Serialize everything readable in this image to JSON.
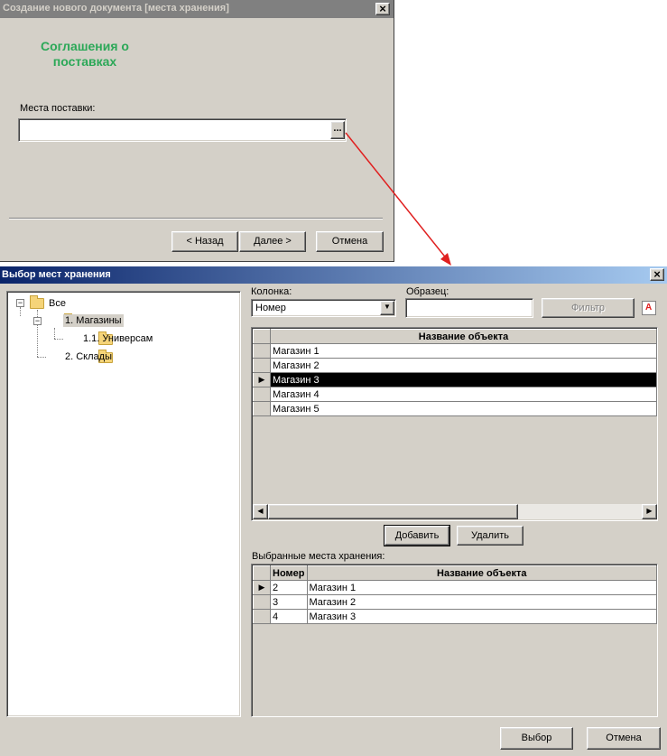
{
  "dialog1": {
    "title": "Создание нового документа [места хранения]",
    "heading_line1": "Соглашения о",
    "heading_line2": "поставках",
    "field_label": "Места поставки:",
    "field_value": "",
    "browse_label": "...",
    "back_label": "< Назад",
    "next_label": "Далее >",
    "cancel_label": "Отмена",
    "close_label": "×"
  },
  "dialog2": {
    "title": "Выбор мест хранения",
    "close_label": "×",
    "tree": {
      "root": "Все",
      "stores": "1. Магазины",
      "supermarket": "1.1. Универсам",
      "warehouses": "2. Склады"
    },
    "column_label": "Колонка:",
    "column_value": "Номер",
    "sample_label": "Образец:",
    "sample_value": "",
    "filter_label": "Фильтр",
    "font_icon_label": "A",
    "table_header": "Название объекта",
    "rows": [
      "Магазин 1",
      "Магазин 2",
      "Магазин 3",
      "Магазин 4",
      "Магазин 5"
    ],
    "selected_row": 2,
    "add_label": "Добавить",
    "remove_label": "Удалить",
    "selected_label": "Выбранные места хранения:",
    "selected_header_num": "Номер",
    "selected_header_name": "Название объекта",
    "selected_rows": [
      {
        "num": "2",
        "name": "Магазин 1"
      },
      {
        "num": "3",
        "name": "Магазин 2"
      },
      {
        "num": "4",
        "name": "Магазин 3"
      }
    ],
    "choose_label": "Выбор",
    "cancel_label": "Отмена"
  },
  "colors": {
    "title_inactive": "#808080",
    "title_active_start": "#0a246a",
    "title_active_end": "#a6caf0",
    "heading_green": "#2ca858",
    "arrow_red": "#e02020"
  }
}
